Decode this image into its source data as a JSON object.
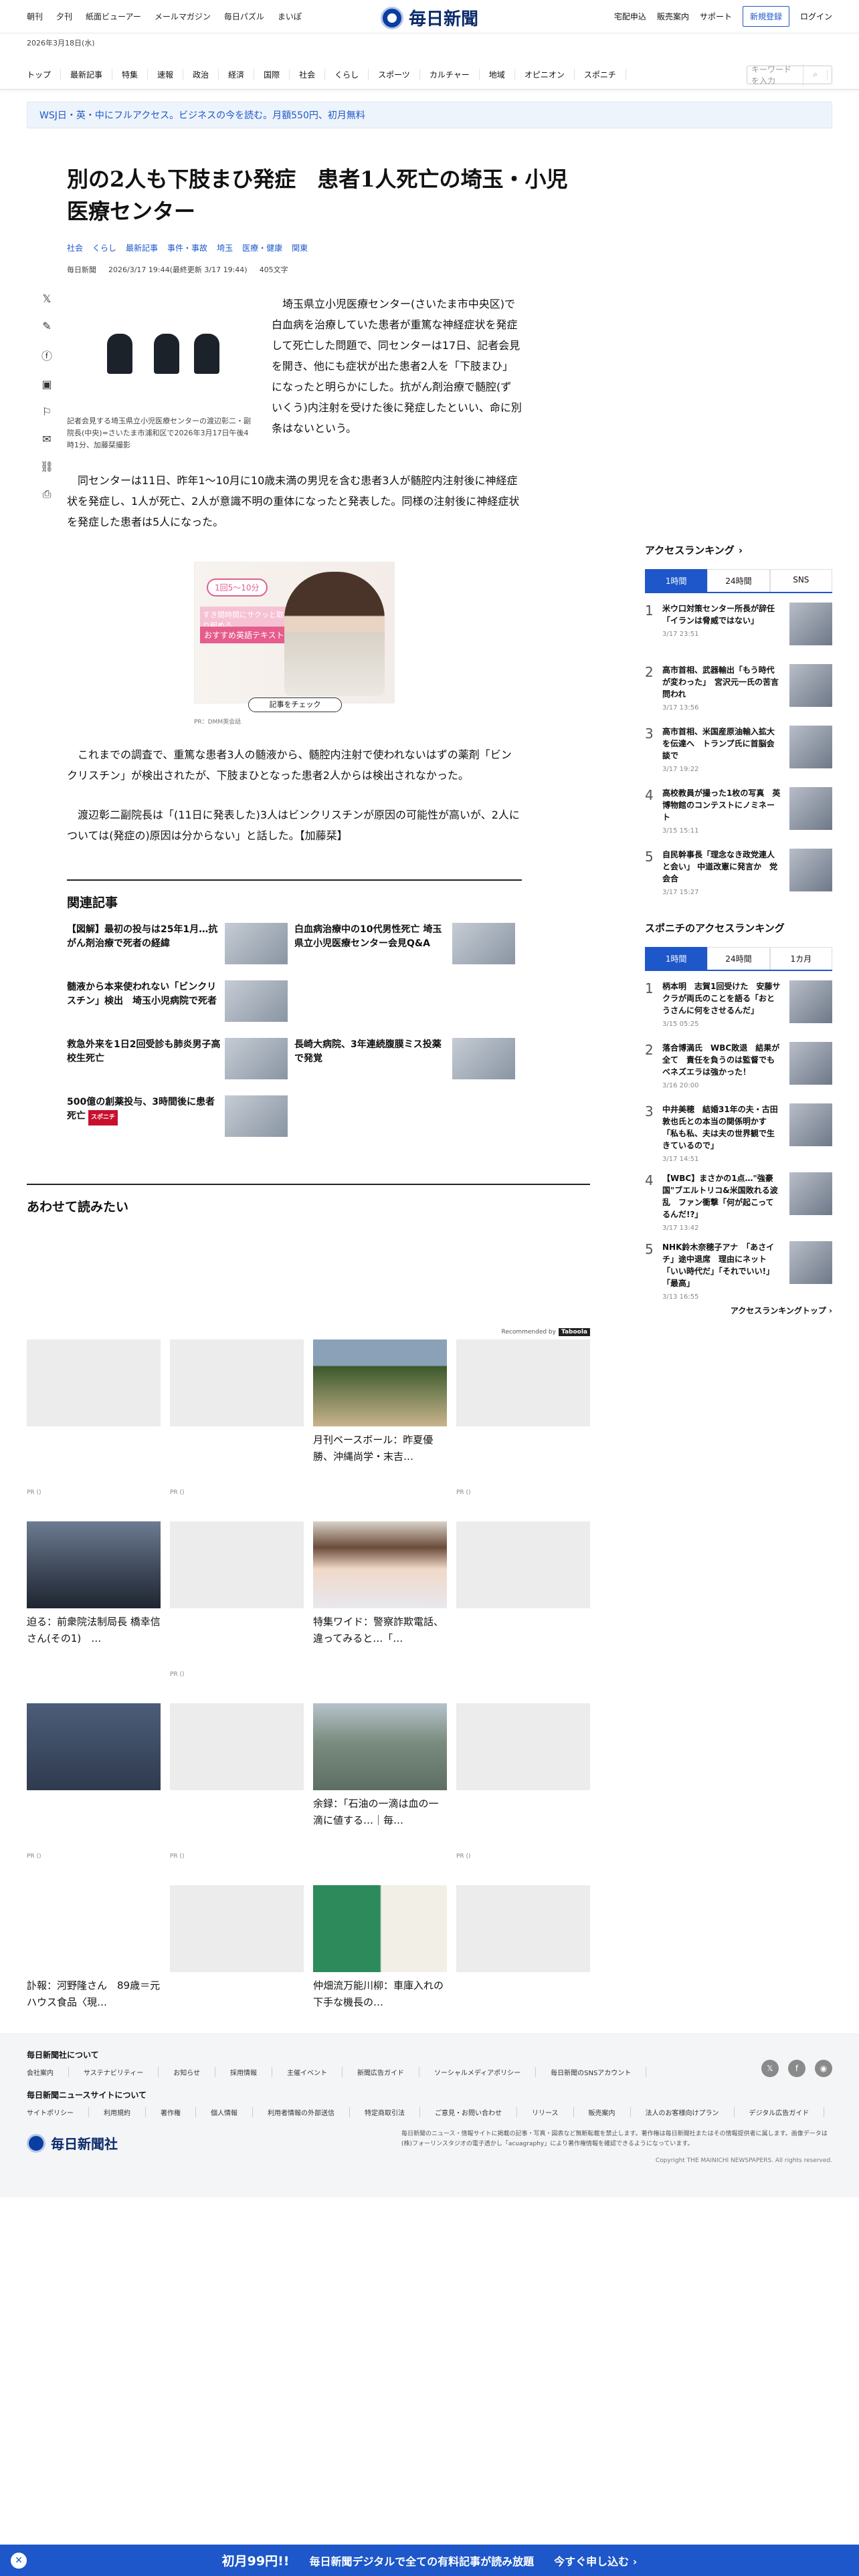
{
  "header": {
    "top_links": [
      "朝刊",
      "夕刊",
      "紙面ビューアー",
      "メールマガジン",
      "毎日パズル",
      "まいぽ"
    ],
    "logo": "毎日新聞",
    "right_links": [
      "宅配申込",
      "販売案内",
      "サポート"
    ],
    "register": "新規登録",
    "login": "ログイン",
    "date": "2026年3月18日(水)"
  },
  "nav": {
    "items": [
      "トップ",
      "最新記事",
      "特集",
      "速報",
      "政治",
      "経済",
      "国際",
      "社会",
      "くらし",
      "スポーツ",
      "カルチャー",
      "地域",
      "オピニオン",
      "スポニチ"
    ],
    "search_placeholder": "キーワードを入力"
  },
  "banner": "WSJ日・英・中にフルアクセス。ビジネスの今を読む。月額550円、初月無料",
  "article": {
    "title": "別の2人も下肢まひ発症　患者1人死亡の埼玉・小児医療センター",
    "tags": [
      "社会",
      "くらし",
      "最新記事",
      "事件・事故",
      "埼玉",
      "医療・健康",
      "関東"
    ],
    "source": "毎日新聞",
    "datetime": "2026/3/17 19:44(最終更新 3/17 19:44)",
    "chars": "405文字",
    "photo_caption": "記者会見する埼玉県立小児医療センターの渡辺彰二・副院長(中央)=さいたま市浦和区で2026年3月17日午後4時1分、加藤栞撮影",
    "lead": "埼玉県立小児医療センター(さいたま市中央区)で白血病を治療していた患者が重篤な神経症状を発症して死亡した問題で、同センターは17日、記者会見を開き、他にも症状が出た患者2人を「下肢まひ」になったと明らかにした。抗がん剤治療で髄腔(ずいくう)内注射を受けた後に発症したといい、命に別条はないという。",
    "p2": "同センターは11日、昨年1～10月に10歳未満の男児を含む患者3人が髄腔内注射後に神経症状を発症し、1人が死亡、2人が意識不明の重体になったと発表した。同様の注射後に神経症状を発症した患者は5人になった。",
    "p3": "これまでの調査で、重篤な患者3人の髄液から、髄腔内注射で使われないはずの薬剤「ビンクリスチン」が検出されたが、下肢まひとなった患者2人からは検出されなかった。",
    "p4": "渡辺彰二副院長は「(11日に発表した)3人はビンクリスチンが原因の可能性が高いが、2人については(発症の)原因は分からない」と話した。【加藤栞】"
  },
  "ad": {
    "pill": "1回5～10分",
    "t1": "すき間時間にサクッと取り組める",
    "t2": "おすすめ英語テキスト",
    "cta": "記事をチェック",
    "pr": "PR：DMM英会話"
  },
  "related": {
    "heading": "関連記事",
    "items": [
      {
        "title": "【図解】最初の投与は25年1月…抗がん剤治療で死者の経緯"
      },
      {
        "title": "白血病治療中の10代男性死亡 埼玉県立小児医療センター会見Q&A"
      },
      {
        "title": "髄液から本来使われない「ビンクリスチン」検出　埼玉小児病院で死者"
      },
      {
        "title": "長崎大病院、3年連続腹膜ミス投薬で発覚"
      },
      {
        "title": "救急外来を1日2回受診も肺炎男子高校生死亡"
      },
      {
        "title": ""
      },
      {
        "title": "500億の創薬投与、3時間後に患者死亡"
      }
    ],
    "sponichi": "スポニチ"
  },
  "awasete": {
    "heading": "あわせて読みたい",
    "recommended": "Recommended by",
    "brand": "Taboola",
    "cards": [
      {
        "title": "",
        "pr": "PR ()"
      },
      {
        "title": "",
        "pr": "PR ()"
      },
      {
        "title": "月刊ベースボール：昨夏優勝、沖縄尚学・末吉…",
        "pr": ""
      },
      {
        "title": "",
        "pr": "PR ()"
      },
      {
        "title": "",
        "pr": "PR ()"
      },
      {
        "title": "",
        "pr": "PR ()"
      },
      {
        "title": "特集ワイド：警察詐欺電話、違ってみると…「…",
        "pr": ""
      },
      {
        "title": "",
        "pr": ""
      },
      {
        "title": "",
        "pr": "PR ()"
      },
      {
        "title": "",
        "pr": "PR ()"
      },
      {
        "title": "余録：「石油の一滴は血の一滴に値する…｜毎…",
        "pr": ""
      },
      {
        "title": "",
        "pr": "PR ()"
      },
      {
        "title": "訃報：河野隆さん　89歳＝元ハウス食品〈現…",
        "pr": ""
      },
      {
        "title": "",
        "pr": "PR ()"
      },
      {
        "title": "仲畑流万能川柳：車庫入れの下手な機長の…",
        "pr": ""
      },
      {
        "title": "",
        "pr": "PR ()"
      }
    ],
    "extra": {
      "title": "迫る：前衆院法制局長 橋幸信さん(その1)　…"
    }
  },
  "ranking": {
    "heading": "アクセスランキング",
    "tabs": [
      "1時間",
      "24時間",
      "SNS"
    ],
    "items": [
      {
        "n": "1",
        "h": "米ウ口対策センター所長が辞任「イランは脅威ではない」",
        "d": "3/17 23:51"
      },
      {
        "n": "2",
        "h": "高市首相、武器輸出「もう時代が変わった」　宮沢元一氏の苦言問われ",
        "d": "3/17 13:56"
      },
      {
        "n": "3",
        "h": "高市首相、米国産原油輸入拡大を伝達へ　トランプ氏に首脳会談で",
        "d": "3/17 19:22"
      },
      {
        "n": "4",
        "h": "高校教員が撮った1枚の写真　英博物館のコンテストにノミネート",
        "d": "3/15 15:11"
      },
      {
        "n": "5",
        "h": "自民幹事長「理念なき政党連人と会い」 中道改憲に発言か　党会合",
        "d": "3/17 15:27"
      }
    ],
    "spon_heading": "スポニチのアクセスランキング",
    "spon_tabs": [
      "1時間",
      "24時間",
      "1カ月"
    ],
    "spon_items": [
      {
        "n": "1",
        "h": "柄本明　志賀1回受けた　安藤サクラが両氏のことを語る「おとうさんに何をさせるんだ」",
        "d": "3/15 05:25"
      },
      {
        "n": "2",
        "h": "落合博満氏　WBC敗退　結果が全て　責任を負うのは監督でもベネズエラは強かった！",
        "d": "3/16 20:00"
      },
      {
        "n": "3",
        "h": "中井美穂　結婚31年の夫・古田敦也氏との本当の関係明かす「私も私、夫は夫の世界観で生きているので」",
        "d": "3/17 14:51"
      },
      {
        "n": "4",
        "h": "【WBC】まさかの1点…\"強豪国\"ブエルトリコ&米国敗れる波乱　ファン衝撃「何が起こってるんだ!?」",
        "d": "3/17 13:42"
      },
      {
        "n": "5",
        "h": "NHK鈴木奈穂子アナ　「あさイチ」途中退席　理由にネット「いい時代だ」「それでいい!」「最高」",
        "d": "3/13 16:55"
      }
    ],
    "more": "アクセスランキングトップ"
  },
  "footer": {
    "h1": "毎日新聞社について",
    "row1": [
      "会社案内",
      "サステナビリティー",
      "お知らせ",
      "採用情報",
      "主催イベント",
      "新聞広告ガイド",
      "ソーシャルメディアポリシー",
      "毎日新聞のSNSアカウント"
    ],
    "h2": "毎日新聞ニュースサイトについて",
    "row2": [
      "サイトポリシー",
      "利用規約",
      "著作権",
      "個人情報",
      "利用者情報の外部送信",
      "特定商取引法",
      "ご意見・お問い合わせ",
      "リリース",
      "販売案内",
      "法人のお客様向けプラン",
      "デジタル広告ガイド"
    ],
    "logo": "毎日新聞社",
    "note": "毎日新聞のニュース・情報サイトに掲載の記事・写真・図表など無断転載を禁止します。著作権は毎日新聞社またはその情報提供者に属します。画像データは(株)フォーリンスタジオの電子透かし「acuagraphy」により著作権情報を確認できるようになっています。",
    "copyright": "Copyright THE MAINICHI NEWSPAPERS. All rights reserved."
  },
  "bottombar": {
    "t1": "初月99円!!",
    "t2": "毎日新聞デジタルで全ての有料記事が読み放題",
    "t3": "今すぐ申し込む ›"
  }
}
